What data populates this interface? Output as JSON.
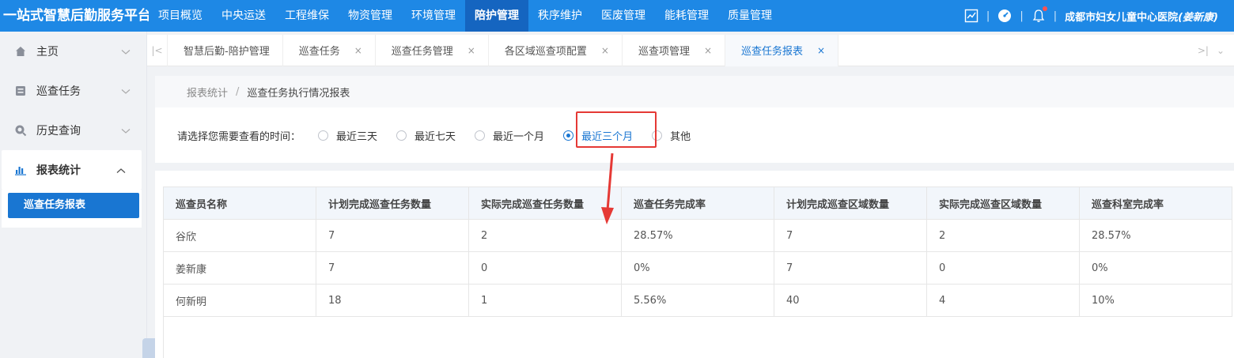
{
  "brand": "一站式智慧后勤服务平台",
  "nav": [
    {
      "label": "项目概览",
      "active": false
    },
    {
      "label": "中央运送",
      "active": false
    },
    {
      "label": "工程维保",
      "active": false
    },
    {
      "label": "物资管理",
      "active": false
    },
    {
      "label": "环境管理",
      "active": false
    },
    {
      "label": "陪护管理",
      "active": true
    },
    {
      "label": "秩序维护",
      "active": false
    },
    {
      "label": "医废管理",
      "active": false
    },
    {
      "label": "能耗管理",
      "active": false
    },
    {
      "label": "质量管理",
      "active": false
    }
  ],
  "header_right": {
    "separator": "|",
    "org": "成都市妇女儿童中心医院",
    "user": "(姜新康)"
  },
  "sidebar": {
    "items": [
      {
        "label": "主页",
        "icon": "home-icon"
      },
      {
        "label": "巡查任务",
        "icon": "task-icon"
      },
      {
        "label": "历史查询",
        "icon": "search-icon"
      },
      {
        "label": "报表统计",
        "icon": "bar-chart-icon"
      }
    ],
    "sub_item": "巡查任务报表"
  },
  "tabs": [
    {
      "label": "智慧后勤-陪护管理",
      "closable": false,
      "active": false
    },
    {
      "label": "巡查任务",
      "closable": true,
      "active": false
    },
    {
      "label": "巡查任务管理",
      "closable": true,
      "active": false
    },
    {
      "label": "各区域巡查项配置",
      "closable": true,
      "active": false
    },
    {
      "label": "巡查项管理",
      "closable": true,
      "active": false
    },
    {
      "label": "巡查任务报表",
      "closable": true,
      "active": true
    }
  ],
  "tab_close_glyph": "×",
  "breadcrumb": {
    "parent": "报表统计",
    "separator": "/",
    "current": "巡查任务执行情况报表"
  },
  "filter": {
    "label": "请选择您需要查看的时间：",
    "options": [
      "最近三天",
      "最近七天",
      "最近一个月",
      "最近三个月",
      "其他"
    ],
    "selected": "最近三个月"
  },
  "table": {
    "headers": [
      "巡查员名称",
      "计划完成巡查任务数量",
      "实际完成巡查任务数量",
      "巡查任务完成率",
      "计划完成巡查区域数量",
      "实际完成巡查区域数量",
      "巡查科室完成率"
    ],
    "rows": [
      [
        "谷欣",
        "7",
        "2",
        "28.57%",
        "7",
        "2",
        "28.57%"
      ],
      [
        "姜新康",
        "7",
        "0",
        "0%",
        "7",
        "0",
        "0%"
      ],
      [
        "何新明",
        "18",
        "1",
        "5.56%",
        "40",
        "4",
        "10%"
      ]
    ]
  },
  "colors": {
    "primary": "#1e88e5",
    "active_nav": "#1565c0",
    "accent": "#1976d2",
    "annotation": "#e53935"
  }
}
